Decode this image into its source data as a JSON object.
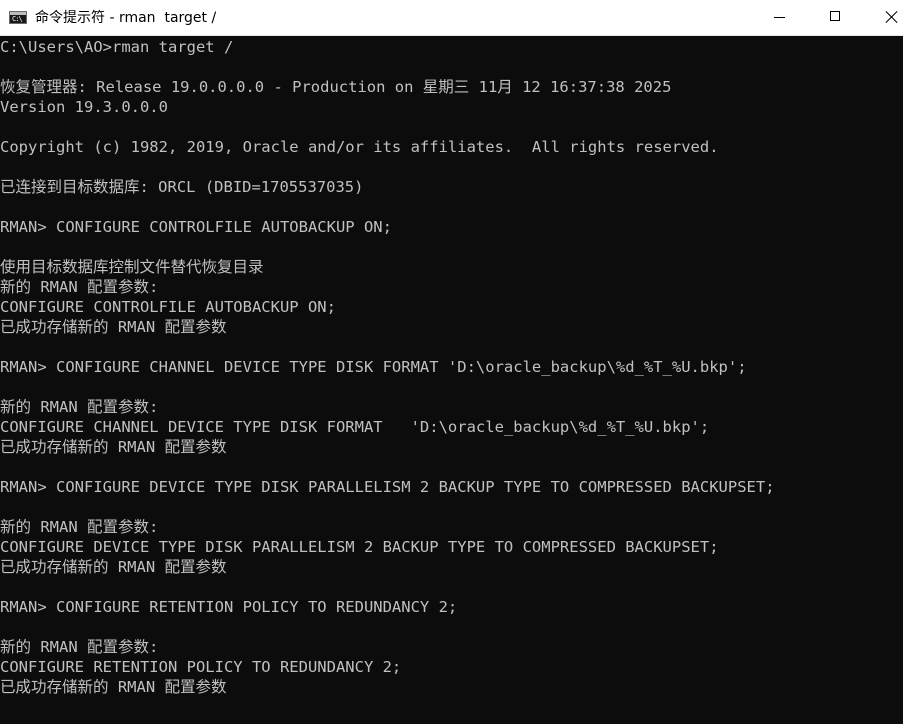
{
  "window": {
    "title": "命令提示符 - rman  target /",
    "icon": "cmd-icon"
  },
  "titlebar_buttons": {
    "minimize_icon": "minimize-icon",
    "maximize_icon": "maximize-icon",
    "close_icon": "close-icon"
  },
  "console": {
    "text_color": "#c0c0c0",
    "background_color": "#0c0c0c",
    "lines": [
      "C:\\Users\\AO>rman target /",
      "",
      "恢复管理器: Release 19.0.0.0.0 - Production on 星期三 11月 12 16:37:38 2025",
      "Version 19.3.0.0.0",
      "",
      "Copyright (c) 1982, 2019, Oracle and/or its affiliates.  All rights reserved.",
      "",
      "已连接到目标数据库: ORCL (DBID=1705537035)",
      "",
      "RMAN> CONFIGURE CONTROLFILE AUTOBACKUP ON;",
      "",
      "使用目标数据库控制文件替代恢复目录",
      "新的 RMAN 配置参数:",
      "CONFIGURE CONTROLFILE AUTOBACKUP ON;",
      "已成功存储新的 RMAN 配置参数",
      "",
      "RMAN> CONFIGURE CHANNEL DEVICE TYPE DISK FORMAT 'D:\\oracle_backup\\%d_%T_%U.bkp';",
      "",
      "新的 RMAN 配置参数:",
      "CONFIGURE CHANNEL DEVICE TYPE DISK FORMAT   'D:\\oracle_backup\\%d_%T_%U.bkp';",
      "已成功存储新的 RMAN 配置参数",
      "",
      "RMAN> CONFIGURE DEVICE TYPE DISK PARALLELISM 2 BACKUP TYPE TO COMPRESSED BACKUPSET;",
      "",
      "新的 RMAN 配置参数:",
      "CONFIGURE DEVICE TYPE DISK PARALLELISM 2 BACKUP TYPE TO COMPRESSED BACKUPSET;",
      "已成功存储新的 RMAN 配置参数",
      "",
      "RMAN> CONFIGURE RETENTION POLICY TO REDUNDANCY 2;",
      "",
      "新的 RMAN 配置参数:",
      "CONFIGURE RETENTION POLICY TO REDUNDANCY 2;",
      "已成功存储新的 RMAN 配置参数"
    ]
  }
}
